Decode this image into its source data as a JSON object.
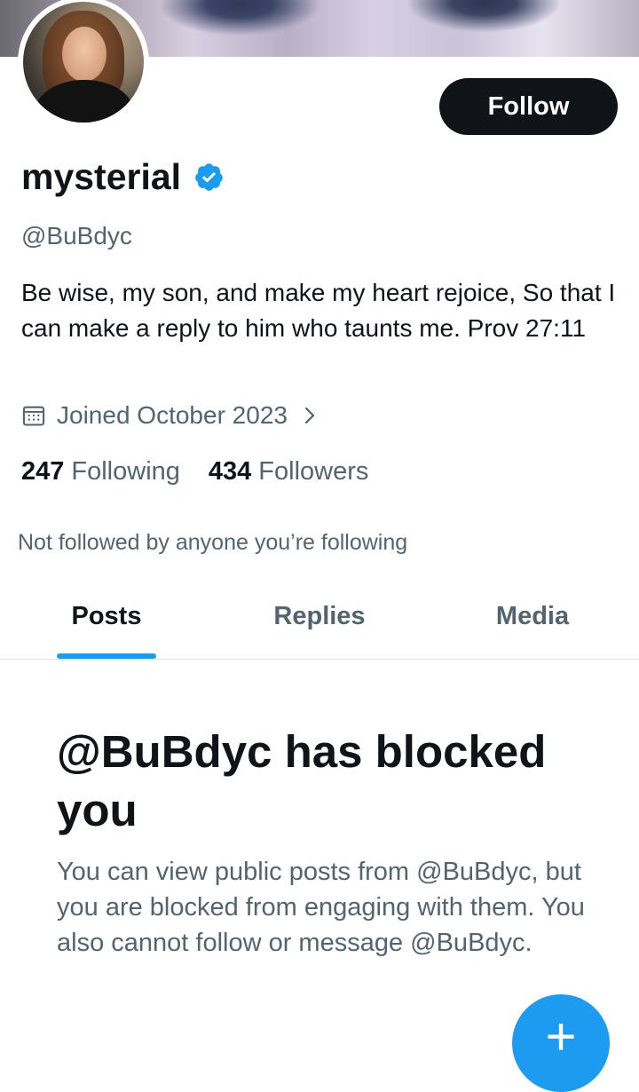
{
  "profile": {
    "display_name": "mysterial",
    "handle": "@BuBdyc",
    "bio": "Be wise, my son, and make my heart rejoice, So that I can make a reply to him who taunts me. Prov 27:11",
    "joined": "Joined October 2023",
    "following_count": "247",
    "following_label": "Following",
    "followers_count": "434",
    "followers_label": "Followers",
    "not_followed_text": "Not followed by anyone you’re following",
    "verified_icon": "verified-badge-icon",
    "verified_color": "#1d9bf0"
  },
  "actions": {
    "follow_label": "Follow",
    "fab_symbol": "+"
  },
  "tabs": [
    {
      "label": "Posts",
      "active": true
    },
    {
      "label": "Replies",
      "active": false
    },
    {
      "label": "Media",
      "active": false
    }
  ],
  "blocked": {
    "title": "@BuBdyc has blocked you",
    "description": "You can view public posts from @BuBdyc, but you are blocked from engaging with them. You also cannot follow or message @BuBdyc."
  },
  "colors": {
    "accent": "#1d9bf0",
    "text_primary": "#0f1419",
    "text_secondary": "#536471"
  }
}
